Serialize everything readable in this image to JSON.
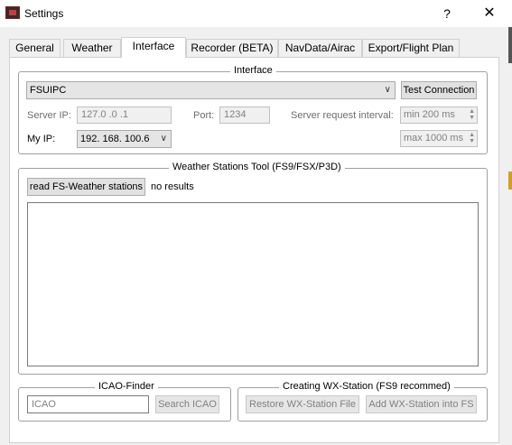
{
  "window": {
    "title": "Settings",
    "help_glyph": "?",
    "close_glyph": "✕"
  },
  "tabs": [
    {
      "label": "General"
    },
    {
      "label": "Weather"
    },
    {
      "label": "Interface"
    },
    {
      "label": "Recorder (BETA)"
    },
    {
      "label": "NavData/Airac"
    },
    {
      "label": "Export/Flight Plan"
    }
  ],
  "interface_group": {
    "title": "Interface",
    "interface_type": "FSUIPC",
    "test_connection_label": "Test Connection",
    "server_ip_label": "Server IP:",
    "server_ip_value": "127.0 .0 .1",
    "port_label": "Port:",
    "port_value": "1234",
    "server_request_interval_label": "Server request interval:",
    "min_interval": "min 200 ms",
    "max_interval": "max 1000 ms",
    "my_ip_label": "My IP:",
    "my_ip_value": "192. 168. 100.6"
  },
  "weather_tool": {
    "title": "Weather Stations Tool (FS9/FSX/P3D)",
    "read_button_label": "read FS-Weather stations",
    "result_text": "no results"
  },
  "icao_finder": {
    "title": "ICAO-Finder",
    "placeholder": "ICAO",
    "search_button_label": "Search ICAO"
  },
  "wx_station": {
    "title": "Creating WX-Station (FS9 recommed)",
    "restore_button_label": "Restore WX-Station File",
    "add_button_label": "Add WX-Station into FS"
  }
}
